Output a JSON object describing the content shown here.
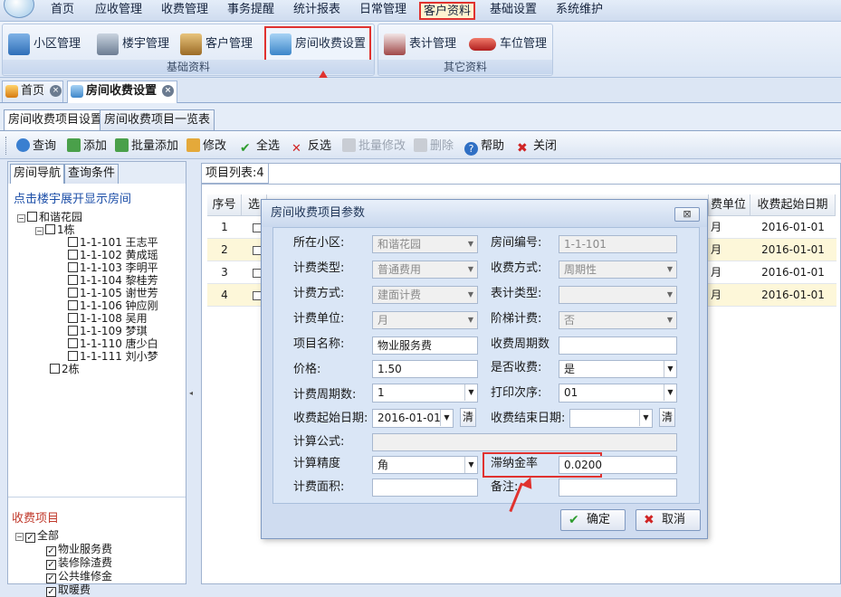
{
  "menu": [
    "首页",
    "应收管理",
    "收费管理",
    "事务提醒",
    "统计报表",
    "日常管理",
    "客户资料",
    "基础设置",
    "系统维护"
  ],
  "ribbon": {
    "groups": [
      {
        "label": "基础资料",
        "buttons": [
          "小区管理",
          "楼宇管理",
          "客户管理",
          "房间收费设置"
        ]
      },
      {
        "label": "其它资料",
        "buttons": [
          "表计管理",
          "车位管理"
        ]
      }
    ]
  },
  "doc_tabs": [
    "首页",
    "房间收费设置"
  ],
  "inner_tabs": [
    "房间收费项目设置",
    "房间收费项目一览表"
  ],
  "toolbar": [
    "查询",
    "添加",
    "批量添加",
    "修改",
    "全选",
    "反选",
    "批量修改",
    "删除",
    "帮助",
    "关闭"
  ],
  "left": {
    "tabs": [
      "房间导航",
      "查询条件"
    ],
    "hint": "点击楼宇展开显示房间",
    "tree_root": "和谐花园",
    "building1": "1栋",
    "rooms": [
      "1-1-101 王志平",
      "1-1-102 黄成瑶",
      "1-1-103 李明平",
      "1-1-104 黎桂芳",
      "1-1-105 谢世芳",
      "1-1-106 钟应刚",
      "1-1-108 吴用",
      "1-1-109 梦琪",
      "1-1-110 唐少白",
      "1-1-111 刘小梦"
    ],
    "building2": "2栋",
    "fee_section": "收费项目",
    "fee_root": "全部",
    "fee_items": [
      "物业服务费",
      "装修除渣费",
      "公共维修金",
      "取暖费"
    ]
  },
  "list": {
    "tab": "项目列表:4",
    "headers": {
      "seq": "序号",
      "sel": "选",
      "unit": "费单位",
      "start": "收费起始日期"
    },
    "rows": [
      {
        "seq": "1",
        "unit": "月",
        "start": "2016-01-01"
      },
      {
        "seq": "2",
        "unit": "月",
        "start": "2016-01-01"
      },
      {
        "seq": "3",
        "unit": "月",
        "start": "2016-01-01"
      },
      {
        "seq": "4",
        "unit": "月",
        "start": "2016-01-01"
      }
    ]
  },
  "dialog": {
    "title": "房间收费项目参数",
    "close": "⊠",
    "labels": {
      "community": "所在小区:",
      "room_no": "房间编号:",
      "fee_type": "计费类型:",
      "charge_mode": "收费方式:",
      "calc_mode": "计费方式:",
      "meter_type": "表计类型:",
      "unit": "计费单位:",
      "tiered": "阶梯计费:",
      "item_name": "项目名称:",
      "charge_cycles": "收费周期数",
      "price": "价格:",
      "is_charge": "是否收费:",
      "calc_cycles": "计费周期数:",
      "print_order": "打印次序:",
      "start_date": "收费起始日期:",
      "end_date": "收费结束日期:",
      "formula": "计算公式:",
      "precision": "计算精度",
      "late_fee": "滞纳金率",
      "area": "计费面积:",
      "note": "备注:"
    },
    "values": {
      "community": "和谐花园",
      "room_no": "1-1-101",
      "fee_type": "普通费用",
      "charge_mode": "周期性",
      "calc_mode": "建面计费",
      "meter_type": "",
      "unit": "月",
      "tiered": "否",
      "item_name": "物业服务费",
      "charge_cycles": "",
      "price": "1.50",
      "is_charge": "是",
      "calc_cycles": "1",
      "print_order": "01",
      "start_date": "2016-01-01",
      "end_date": "",
      "formula": "",
      "precision": "角",
      "late_fee": "0.0200",
      "area": "",
      "note": ""
    },
    "clear_btn": "清",
    "ok": "确定",
    "cancel": "取消"
  },
  "colors": {
    "highlight": "#e0322f",
    "accent": "#c9d8ee"
  }
}
